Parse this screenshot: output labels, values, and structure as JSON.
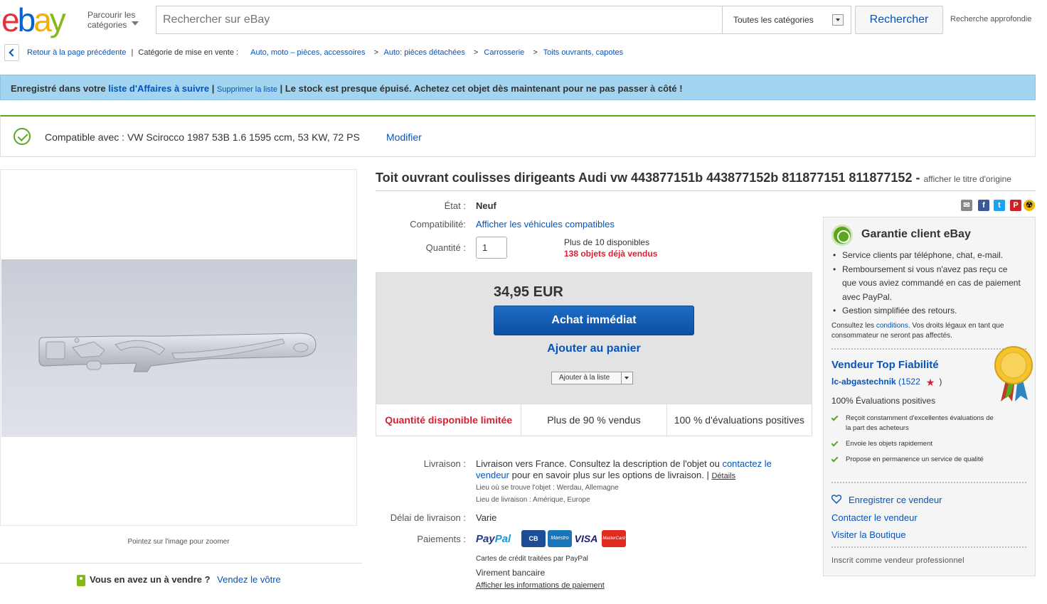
{
  "header": {
    "logo_e": "e",
    "logo_b": "b",
    "logo_a": "a",
    "logo_y": "y",
    "browse_line1": "Parcourir les",
    "browse_line2": "catégories",
    "search_placeholder": "Rechercher sur eBay",
    "category_select": "Toutes les catégories",
    "search_button": "Rechercher",
    "advanced_search": "Recherche approfondie"
  },
  "breadcrumb": {
    "back": "Retour à la page précédente",
    "category_label": "Catégorie de mise en vente :",
    "items": [
      "Auto, moto – pièces, accessoires",
      "Auto: pièces détachées",
      "Carrosserie",
      "Toits ouvrants, capotes"
    ],
    "separator": ">"
  },
  "banner": {
    "prefix": "Enregistré dans votre",
    "watch_link": "liste d'Affaires à suivre",
    "pipe1": "|",
    "remove_link": "Supprimer la liste",
    "message": "| Le stock est presque épuisé. Achetez cet objet dès maintenant pour ne pas passer à côté !"
  },
  "compat": {
    "label": "Compatible avec :",
    "vehicle": "VW Scirocco 1987 53B 1.6 1595 ccm, 53 KW, 72 PS",
    "edit": "Modifier"
  },
  "image": {
    "zoom_hint": "Pointez sur l'image pour zoomer"
  },
  "sell": {
    "question": "Vous en avez un à vendre ?",
    "link": "Vendez le vôtre"
  },
  "item": {
    "title": "Toit ouvrant coulisses dirigeants Audi vw 443877151b 443877152b 811877151 811877152 -",
    "original_title": "afficher le titre d'origine",
    "condition_label": "État :",
    "condition_value": "Neuf",
    "compat_label": "Compatibilité:",
    "compat_link": "Afficher les véhicules compatibles",
    "qty_label": "Quantité :",
    "qty_value": "1",
    "available": "Plus de 10 disponibles",
    "sold": "138 objets déjà vendus",
    "price": "34,95 EUR",
    "buy_now": "Achat immédiat",
    "add_cart": "Ajouter au panier",
    "add_watch": "Ajouter à la liste",
    "stats": [
      "Quantité disponible limitée",
      "Plus de 90 % vendus",
      "100 % d'évaluations positives"
    ],
    "shipping_label": "Livraison :",
    "shipping_text1": "Livraison vers France. Consultez la description de l'objet ou",
    "shipping_link": "contactez le vendeur",
    "shipping_text2": "pour en savoir plus sur les options de livraison. |",
    "shipping_details": "Détails",
    "item_location": "Lieu où se trouve l'objet : Werdau, Allemagne",
    "ships_to": "Lieu de livraison : Amérique, Europe",
    "delivery_label": "Délai de livraison :",
    "delivery_value": "Varie",
    "payments_label": "Paiements :",
    "paypal_a": "Pay",
    "paypal_b": "Pal",
    "card_cb": "CB",
    "card_maestro": "Maestro",
    "card_visa": "VISA",
    "card_mc": "MasterCard",
    "card_note": "Cartes de crédit traitées par PayPal",
    "bank_transfer": "Virement bancaire",
    "payment_info": "Afficher les informations de paiement"
  },
  "share": {
    "email": "✉",
    "facebook": "f",
    "twitter": "t",
    "pinterest": "P",
    "other": "☢"
  },
  "sidebar": {
    "guarantee_title": "Garantie client eBay",
    "guarantee_items": [
      "Service clients par téléphone, chat, e-mail.",
      "Remboursement si vous n'avez pas reçu ce que vous aviez commandé en cas de paiement avec PayPal.",
      "Gestion simplifiée des retours."
    ],
    "note_prefix": "Consultez les",
    "note_link": "conditions",
    "note_suffix": ". Vos droits légaux en tant que consommateur ne seront pas affectés.",
    "top_rated_title": "Vendeur Top Fiabilité",
    "seller_name": "lc-abgastechnik",
    "seller_score_open": "(1522",
    "seller_score_close": ")",
    "positive": "100% Évaluations positives",
    "perks": [
      "Reçoit constamment d'excellentes évaluations de la part des acheteurs",
      "Envoie les objets rapidement",
      "Propose en permanence un service de qualité"
    ],
    "save_seller": "Enregistrer ce vendeur",
    "contact_seller": "Contacter le vendeur",
    "visit_store": "Visiter la Boutique",
    "pro_seller": "Inscrit comme vendeur professionnel"
  },
  "colors": {
    "accent": "#0654ba",
    "green": "#5ba71b",
    "red": "#dd1e31",
    "banner": "#a3d4f0"
  }
}
